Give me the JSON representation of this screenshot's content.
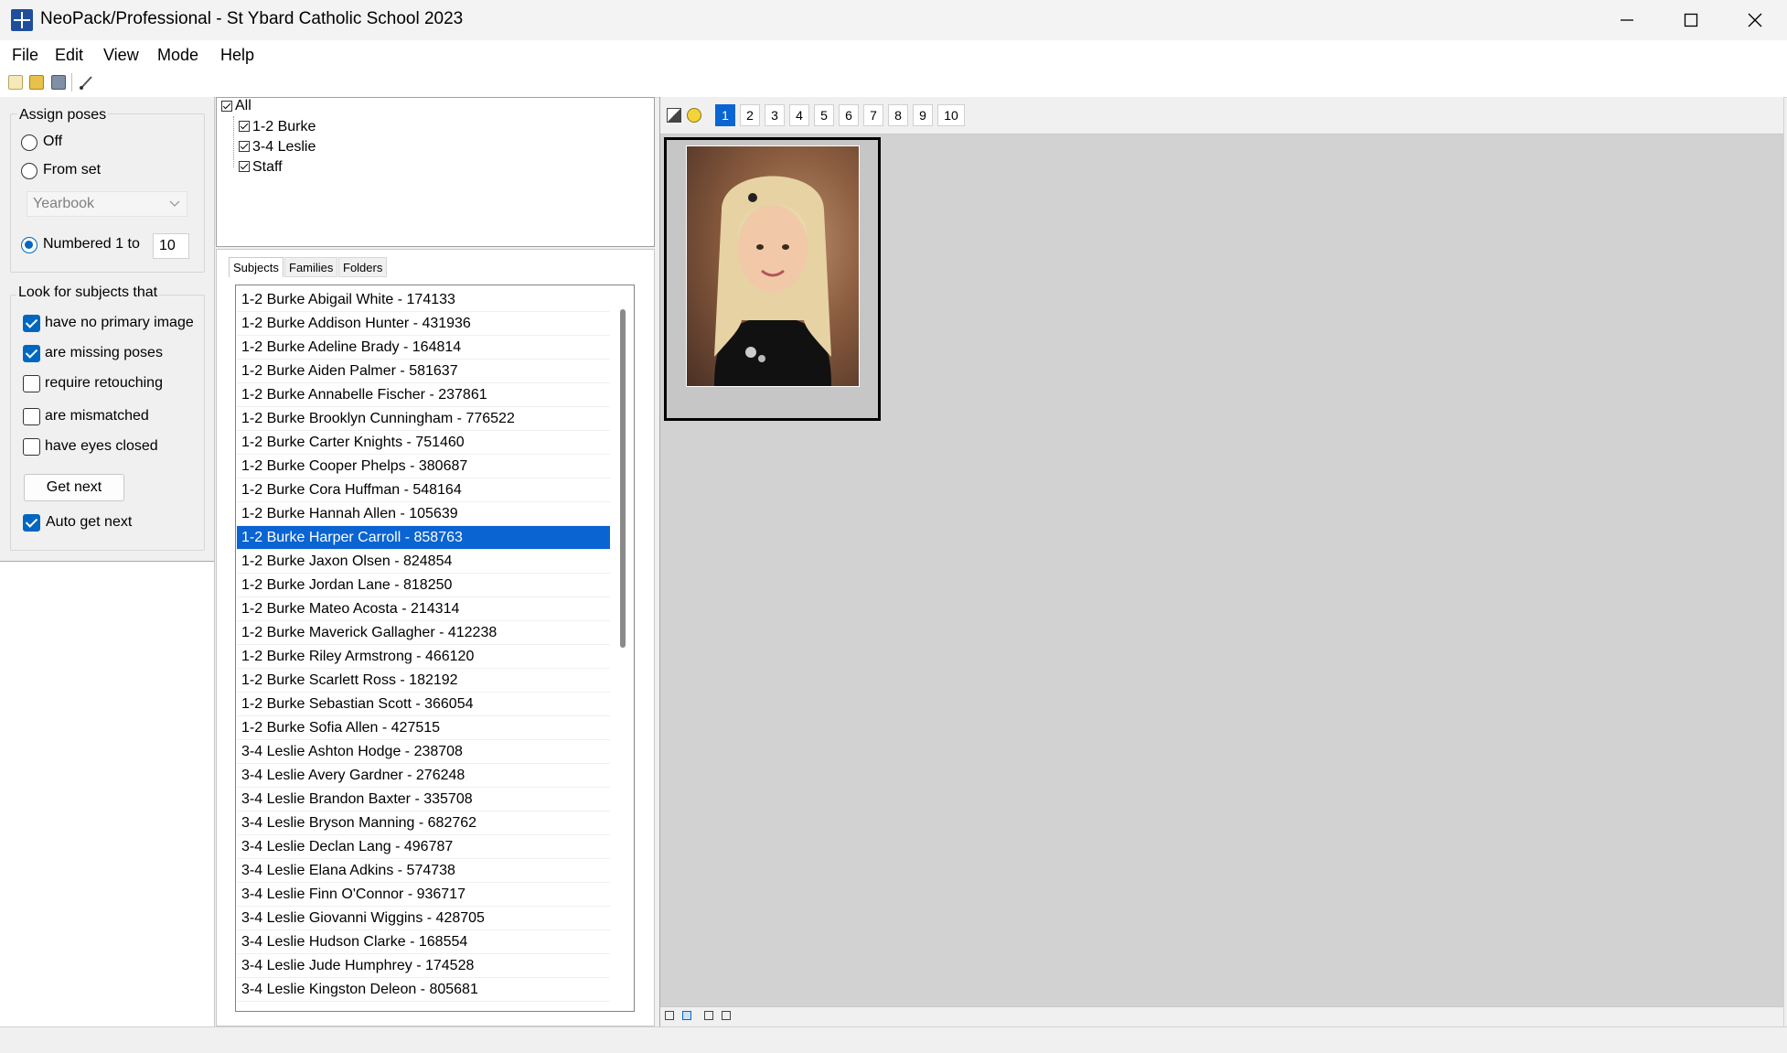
{
  "window": {
    "title": "NeoPack/Professional - St Ybard Catholic School 2023"
  },
  "menu": [
    "File",
    "Edit",
    "View",
    "Mode",
    "Help"
  ],
  "toolbar": {
    "icons": [
      "new-icon",
      "open-icon",
      "save-icon",
      "brush-icon"
    ]
  },
  "assign_poses": {
    "title": "Assign poses",
    "off_label": "Off",
    "from_set_label": "From set",
    "set_value": "Yearbook",
    "numbered_label": "Numbered 1 to",
    "numbered_value": "10",
    "selected": "numbered"
  },
  "look_for": {
    "title": "Look for subjects that",
    "options": [
      {
        "label": "have no primary image",
        "checked": true
      },
      {
        "label": "are missing poses",
        "checked": true
      },
      {
        "label": "require retouching",
        "checked": false
      },
      {
        "label": "are mismatched",
        "checked": false
      },
      {
        "label": "have eyes closed",
        "checked": false
      }
    ],
    "get_next_label": "Get next",
    "auto_get_next_label": "Auto get next",
    "auto_get_next_checked": true
  },
  "tree": {
    "root": "All",
    "children": [
      "1-2 Burke",
      "3-4 Leslie",
      "Staff"
    ]
  },
  "tabs": [
    "Subjects",
    "Families",
    "Folders"
  ],
  "subjects": [
    "1-2 Burke Abigail White - 174133",
    "1-2 Burke Addison Hunter - 431936",
    "1-2 Burke Adeline Brady - 164814",
    "1-2 Burke Aiden Palmer - 581637",
    "1-2 Burke Annabelle Fischer - 237861",
    "1-2 Burke Brooklyn Cunningham - 776522",
    "1-2 Burke Carter Knights - 751460",
    "1-2 Burke Cooper Phelps - 380687",
    "1-2 Burke Cora Huffman - 548164",
    "1-2 Burke Hannah Allen - 105639",
    "1-2 Burke Harper Carroll - 858763",
    "1-2 Burke Jaxon Olsen - 824854",
    "1-2 Burke Jordan Lane - 818250",
    "1-2 Burke Mateo Acosta - 214314",
    "1-2 Burke Maverick Gallagher - 412238",
    "1-2 Burke Riley Armstrong - 466120",
    "1-2 Burke Scarlett Ross - 182192",
    "1-2 Burke Sebastian Scott - 366054",
    "1-2 Burke Sofia Allen - 427515",
    "3-4 Leslie Ashton Hodge - 238708",
    "3-4 Leslie Avery Gardner - 276248",
    "3-4 Leslie Brandon Baxter - 335708",
    "3-4 Leslie Bryson Manning - 682762",
    "3-4 Leslie Declan Lang - 496787",
    "3-4 Leslie Elana Adkins - 574738",
    "3-4 Leslie Finn O'Connor - 936717",
    "3-4 Leslie Giovanni Wiggins - 428705",
    "3-4 Leslie Hudson Clarke - 168554",
    "3-4 Leslie Jude Humphrey - 174528",
    "3-4 Leslie Kingston Deleon - 805681"
  ],
  "selected_subject_index": 10,
  "poses": [
    "1",
    "2",
    "3",
    "4",
    "5",
    "6",
    "7",
    "8",
    "9",
    "10"
  ],
  "active_pose": "1",
  "colors": {
    "selection": "#0a64d2",
    "accent": "#0067c0"
  }
}
